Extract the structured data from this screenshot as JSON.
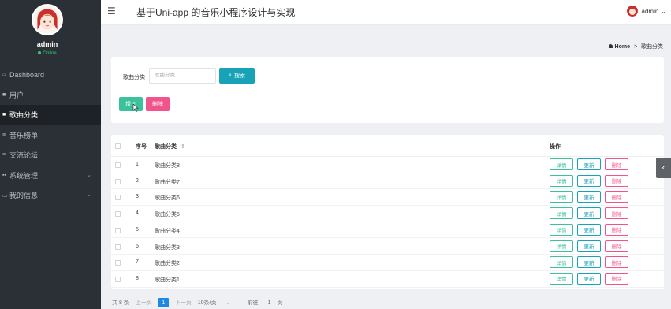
{
  "sidebar": {
    "username": "admin",
    "status": "Online",
    "items": [
      {
        "icon": "⌂",
        "label": "Dashboard",
        "active": false
      },
      {
        "icon": "■",
        "label": "用户",
        "active": false
      },
      {
        "icon": "■",
        "label": "歌曲分类",
        "active": true
      },
      {
        "icon": "≡",
        "label": "音乐榜单",
        "active": false
      },
      {
        "icon": "≡",
        "label": "交流论坛",
        "active": false
      },
      {
        "icon": "▪▪",
        "label": "系统管理",
        "active": false,
        "caret": "⌄"
      },
      {
        "icon": "▭",
        "label": "我的信息",
        "active": false,
        "caret": "⌄"
      }
    ]
  },
  "header": {
    "title": "基于Uni-app 的音乐小程序设计与实现",
    "user": "admin",
    "user_caret": "⌄"
  },
  "breadcrumb": {
    "home": "Home",
    "sep": ">",
    "current": "歌曲分类"
  },
  "search": {
    "label": "歌曲分类",
    "placeholder": "歌曲分类",
    "button": "搜索"
  },
  "actions": {
    "add": "增加",
    "delete": "删除"
  },
  "table": {
    "headers": {
      "index": "序号",
      "category": "歌曲分类",
      "sort_icon": "⇕",
      "ops": "操作"
    },
    "ops": {
      "detail": "详情",
      "update": "更新",
      "delete": "删除"
    },
    "rows": [
      {
        "index": "1",
        "category": "歌曲分类8"
      },
      {
        "index": "2",
        "category": "歌曲分类7"
      },
      {
        "index": "3",
        "category": "歌曲分类6"
      },
      {
        "index": "4",
        "category": "歌曲分类5"
      },
      {
        "index": "5",
        "category": "歌曲分类4"
      },
      {
        "index": "6",
        "category": "歌曲分类3"
      },
      {
        "index": "7",
        "category": "歌曲分类2"
      },
      {
        "index": "8",
        "category": "歌曲分类1"
      }
    ]
  },
  "pagination": {
    "total": "共 8 条",
    "prev": "上一页",
    "current": "1",
    "next": "下一页",
    "page_size": "10条/页",
    "goto_label": "前往",
    "goto_value": "1",
    "goto_suffix": "页"
  },
  "colors": {
    "sidebar_bg": "#2a3035",
    "accent_teal": "#17a2b8",
    "success_green": "#3cc19d",
    "danger_pink": "#f0548a",
    "page_active": "#1e88e5"
  }
}
